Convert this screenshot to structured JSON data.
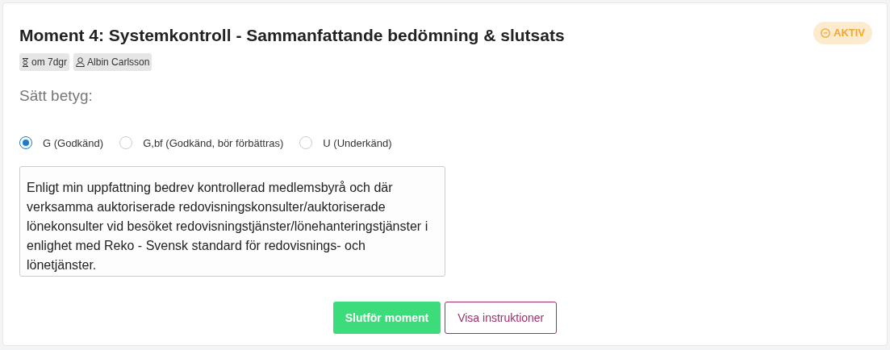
{
  "card": {
    "title": "Moment 4: Systemkontroll - Sammanfattande bedömning & slutsats",
    "status": {
      "label": "AKTIV"
    },
    "tags": [
      {
        "kind": "deadline",
        "label": "om 7dgr"
      },
      {
        "kind": "person",
        "label": "Albin Carlsson"
      }
    ],
    "grade_heading": "Sätt betyg:",
    "grades": [
      {
        "label": "G (Godkänd)",
        "selected": true
      },
      {
        "label": "G,bf (Godkänd, bör förbättras)",
        "selected": false
      },
      {
        "label": "U (Underkänd)",
        "selected": false
      }
    ],
    "comment": {
      "value": "Enligt min uppfattning bedrev kontrollerad medlemsbyrå och där verksamma auktoriserade redovisningskonsulter/auktoriserade lönekonsulter vid besöket redovisningstjänster/lönehanteringstjänster i enlighet med Reko - Svensk standard för redovisnings- och lönetjänster."
    },
    "buttons": [
      {
        "kind": "primary",
        "label": "Slutför moment"
      },
      {
        "kind": "outline",
        "label": "Visa instruktioner"
      }
    ]
  }
}
